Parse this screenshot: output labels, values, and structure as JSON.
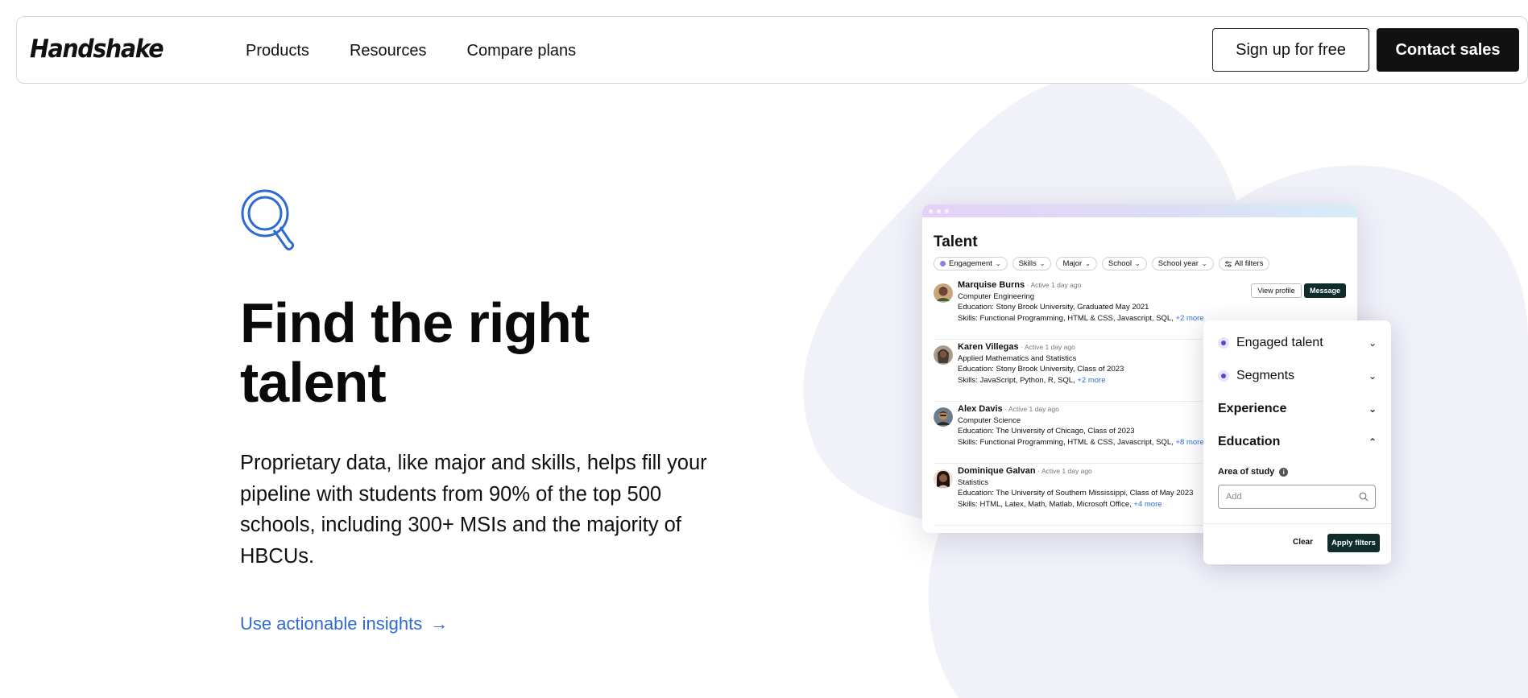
{
  "nav": {
    "logo": "Handshake",
    "links": [
      "Products",
      "Resources",
      "Compare plans"
    ],
    "signup_label": "Sign up for free",
    "contact_label": "Contact sales"
  },
  "hero": {
    "icon": "search-magnifier-icon",
    "title_line1": "Find the right",
    "title_line2": "talent",
    "description": "Proprietary data, like major and skills, helps fill your pipeline with students from 90% of the top 500 schools, including 300+ MSIs and the majority of HBCUs.",
    "link_label": "Use actionable insights",
    "link_arrow": "→"
  },
  "mock": {
    "title": "Talent",
    "chips": [
      "Engagement",
      "Skills",
      "Major",
      "School",
      "School year",
      "All filters"
    ],
    "view_profile_label": "View profile",
    "message_label": "Message",
    "candidates": [
      {
        "name": "Marquise Burns",
        "active": "· Active 1 day ago",
        "major": "Computer Engineering",
        "education_label": "Education:",
        "education": "Stony Brook University, Graduated May 2021",
        "skills_label": "Skills:",
        "skills": "Functional Programming, HTML & CSS, Javascript, SQL,",
        "more": "+2 more"
      },
      {
        "name": "Karen Villegas",
        "active": "· Active 1 day ago",
        "major": "Applied Mathematics and Statistics",
        "education_label": "Education:",
        "education": "Stony Brook University, Class of 2023",
        "skills_label": "Skills:",
        "skills": "JavaScript, Python, R, SQL,",
        "more": "+2 more"
      },
      {
        "name": "Alex Davis",
        "active": "· Active 1 day ago",
        "major": "Computer Science",
        "education_label": "Education:",
        "education": "The University of Chicago, Class of 2023",
        "skills_label": "Skills:",
        "skills": "Functional Programming, HTML & CSS, Javascript, SQL,",
        "more": "+8 more"
      },
      {
        "name": "Dominique Galvan",
        "active": "· Active 1 day ago",
        "major": "Statistics",
        "education_label": "Education:",
        "education": "The University of Southern Mississippi, Class of May 2023",
        "skills_label": "Skills:",
        "skills": "HTML, Latex, Math, Matlab, Microsoft Office,",
        "more": "+4 more"
      }
    ]
  },
  "filter_panel": {
    "items": [
      "Engaged talent",
      "Segments",
      "Experience",
      "Education"
    ],
    "area_label": "Area of study",
    "area_placeholder": "Add",
    "clear_label": "Clear",
    "apply_label": "Apply filters"
  },
  "colors": {
    "accent_blue": "#2d6bd1",
    "dark_button": "#111111",
    "teal_button": "#0f2d2d",
    "blob": "#f1f1fa",
    "purple_dot": "#5947c9"
  }
}
